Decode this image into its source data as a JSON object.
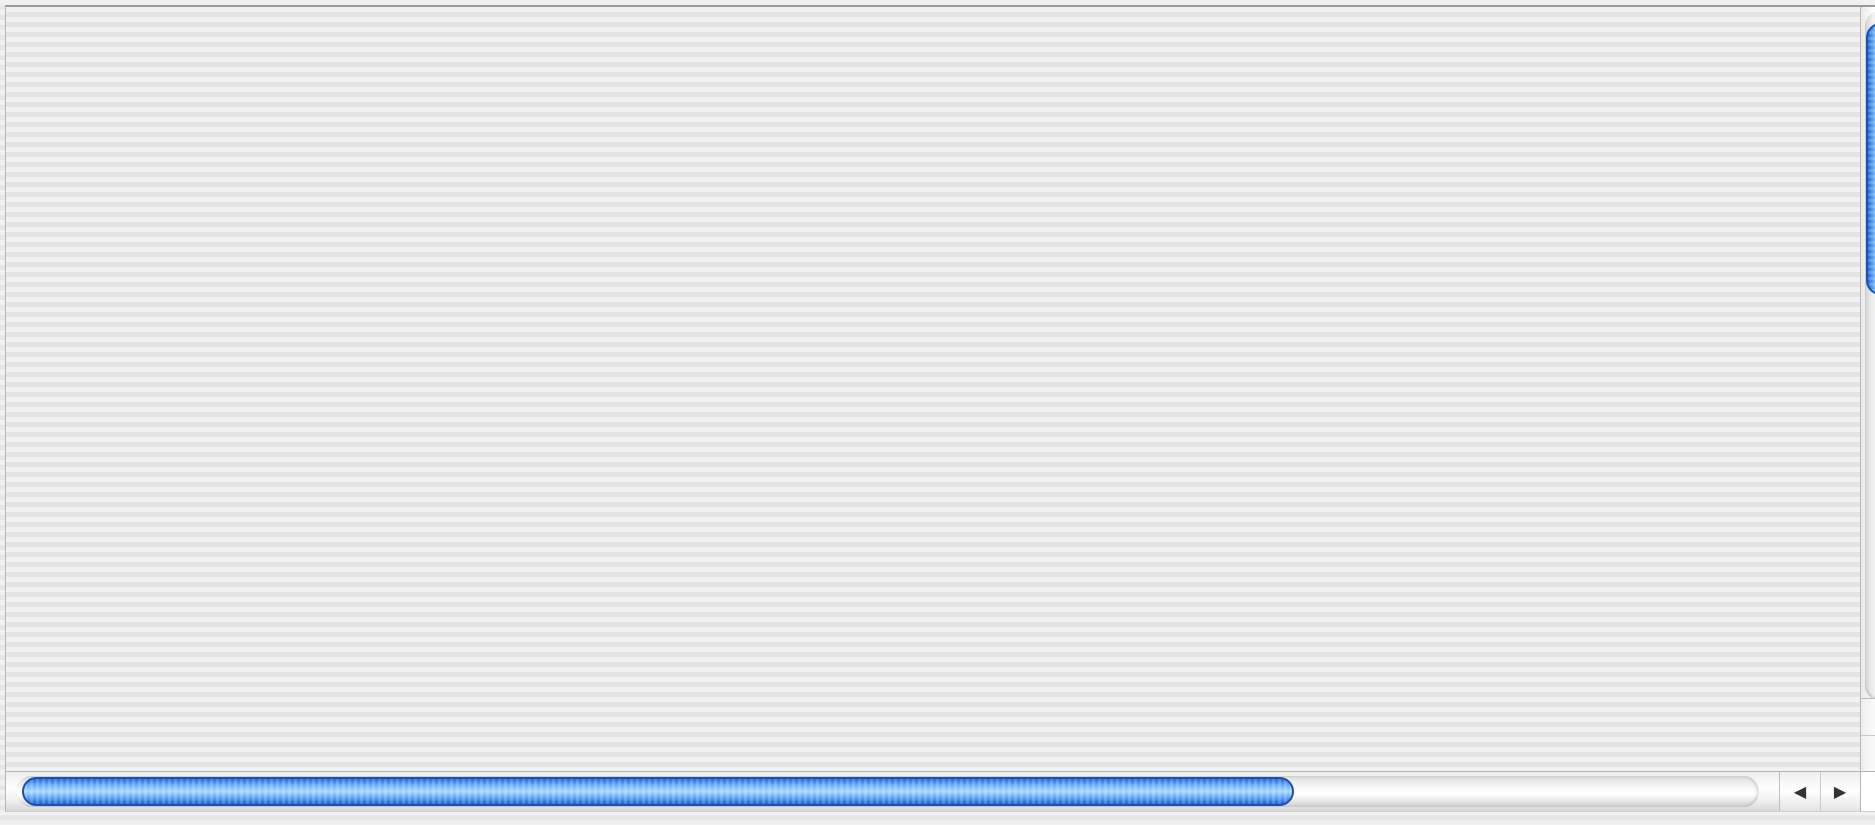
{
  "scroll_view": {
    "vertical": {
      "position": 0.0,
      "visible_fraction": 0.4
    },
    "horizontal": {
      "position": 0.0,
      "visible_fraction": 0.73
    },
    "icons": {
      "up": "▲",
      "down": "▼",
      "left": "◀",
      "right": "▶"
    },
    "accent_color": "#3a8ee6"
  }
}
